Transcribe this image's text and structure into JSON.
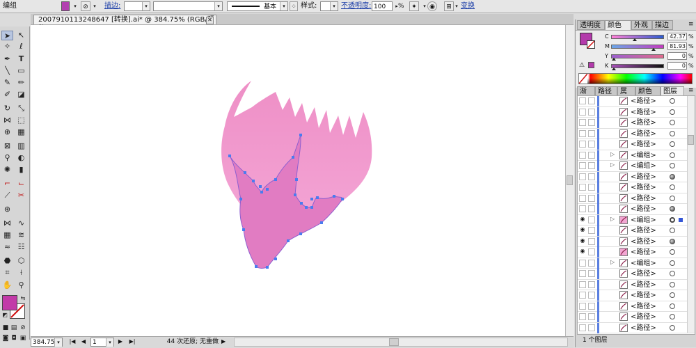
{
  "control_bar": {
    "group_label": "编组",
    "stroke_link": "描边:",
    "profile_label": "基本",
    "style_label": "样式:",
    "opacity_link": "不透明度:",
    "opacity_value": "100",
    "opacity_unit": "%",
    "transform_link": "变换",
    "fill_color": "#b23fb0"
  },
  "document": {
    "tab_title": "2007910113248647 [转换].ai* @ 384.75% (RGB/预览)",
    "close_glyph": "✕"
  },
  "toolbox": {
    "fill_color": "#c23aa8",
    "stroke_color": "#ffffff"
  },
  "status_bar": {
    "zoom": "384.75%",
    "page": "1",
    "undo_text": "44 次还原; 无重做"
  },
  "color_panel": {
    "tabs": [
      "透明度",
      "颜色",
      "外观",
      "描边"
    ],
    "active_tab": "颜色",
    "swatch_color": "#b33aab",
    "sliders": [
      {
        "label": "C",
        "value": "42.37",
        "unit": "%"
      },
      {
        "label": "M",
        "value": "81.93",
        "unit": "%"
      },
      {
        "label": "Y",
        "value": "0",
        "unit": "%"
      },
      {
        "label": "K",
        "value": "0",
        "unit": "%"
      }
    ]
  },
  "layers_panel": {
    "tabs": [
      "渐变",
      "路径查",
      "属性",
      "颜色参",
      "图层"
    ],
    "active_tab": "图层",
    "rows": [
      {
        "name": "<路径>",
        "eye": false,
        "group": false,
        "target": "empty"
      },
      {
        "name": "<路径>",
        "eye": false,
        "group": false,
        "target": "empty"
      },
      {
        "name": "<路径>",
        "eye": false,
        "group": false,
        "target": "empty"
      },
      {
        "name": "<路径>",
        "eye": false,
        "group": false,
        "target": "empty"
      },
      {
        "name": "<路径>",
        "eye": false,
        "group": false,
        "target": "empty"
      },
      {
        "name": "<编组>",
        "eye": false,
        "group": true,
        "target": "empty"
      },
      {
        "name": "<编组>",
        "eye": false,
        "group": true,
        "target": "empty"
      },
      {
        "name": "<路径>",
        "eye": false,
        "group": false,
        "target": "filled"
      },
      {
        "name": "<路径>",
        "eye": false,
        "group": false,
        "target": "empty"
      },
      {
        "name": "<路径>",
        "eye": false,
        "group": false,
        "target": "empty"
      },
      {
        "name": "<路径>",
        "eye": false,
        "group": false,
        "target": "filled"
      },
      {
        "name": "<编组>",
        "eye": true,
        "group": true,
        "target": "selected"
      },
      {
        "name": "<路径>",
        "eye": true,
        "group": false,
        "target": "empty"
      },
      {
        "name": "<路径>",
        "eye": true,
        "group": false,
        "target": "filled"
      },
      {
        "name": "<路径>",
        "eye": true,
        "group": false,
        "target": "empty"
      },
      {
        "name": "<编组>",
        "eye": false,
        "group": true,
        "target": "empty"
      },
      {
        "name": "<路径>",
        "eye": false,
        "group": false,
        "target": "empty"
      },
      {
        "name": "<路径>",
        "eye": false,
        "group": false,
        "target": "empty"
      },
      {
        "name": "<路径>",
        "eye": false,
        "group": false,
        "target": "empty"
      },
      {
        "name": "<路径>",
        "eye": false,
        "group": false,
        "target": "empty"
      },
      {
        "name": "<路径>",
        "eye": false,
        "group": false,
        "target": "empty"
      },
      {
        "name": "<路径>",
        "eye": false,
        "group": false,
        "target": "empty"
      }
    ],
    "footer": "1 个图层"
  },
  "artwork": {
    "outer_fill_top": "#ee8fc6",
    "outer_fill_bottom": "#f4a6d6",
    "inner_fill": "#e17cc2",
    "inner_stroke": "#8c5fd0",
    "anchor_color": "#4a7bef"
  }
}
